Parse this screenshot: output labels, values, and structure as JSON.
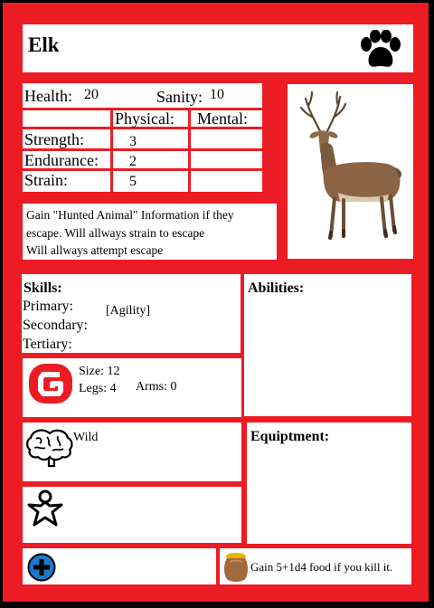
{
  "card": {
    "name": "Elk",
    "type_icon": "paw-print-icon",
    "portrait": "elk-illustration"
  },
  "stats": {
    "health_label": "Health:",
    "health_value": "20",
    "sanity_label": "Sanity:",
    "sanity_value": "10",
    "physical_header": "Physical:",
    "mental_header": "Mental:",
    "rows": [
      {
        "label": "Strength:",
        "physical": "3",
        "mental": ""
      },
      {
        "label": "Endurance:",
        "physical": "2",
        "mental": ""
      },
      {
        "label": "Strain:",
        "physical": "5",
        "mental": ""
      }
    ]
  },
  "info": {
    "lines": [
      "Gain \"Hunted Animal\" Information if they",
      "escape.  Will allways strain to escape",
      "Will allways attempt escape"
    ]
  },
  "skills": {
    "title": "Skills:",
    "primary_label": "Primary:",
    "primary_value": "[Agility]",
    "secondary_label": "Secondary:",
    "tertiary_label": "Tertiary:"
  },
  "abilities": {
    "title": "Abilities:"
  },
  "body": {
    "icon": "g-badge-icon",
    "size_label": "Size: 12",
    "legs_label": "Legs: 4",
    "arms_label": "Arms: 0"
  },
  "mind": {
    "icon": "brain-icon",
    "label": "Wild"
  },
  "equipment": {
    "title": "Equiptment:"
  },
  "person": {
    "icon": "person-star-icon"
  },
  "plus": {
    "icon": "plus-circle-icon"
  },
  "loot": {
    "icon": "honey-pot-icon",
    "text": "Gain 5+1d4 food if you kill it."
  },
  "colors": {
    "frame": "#ed1c24",
    "badge": "#ed1c24",
    "plus": "#1e78c8",
    "outer": "#000000"
  }
}
